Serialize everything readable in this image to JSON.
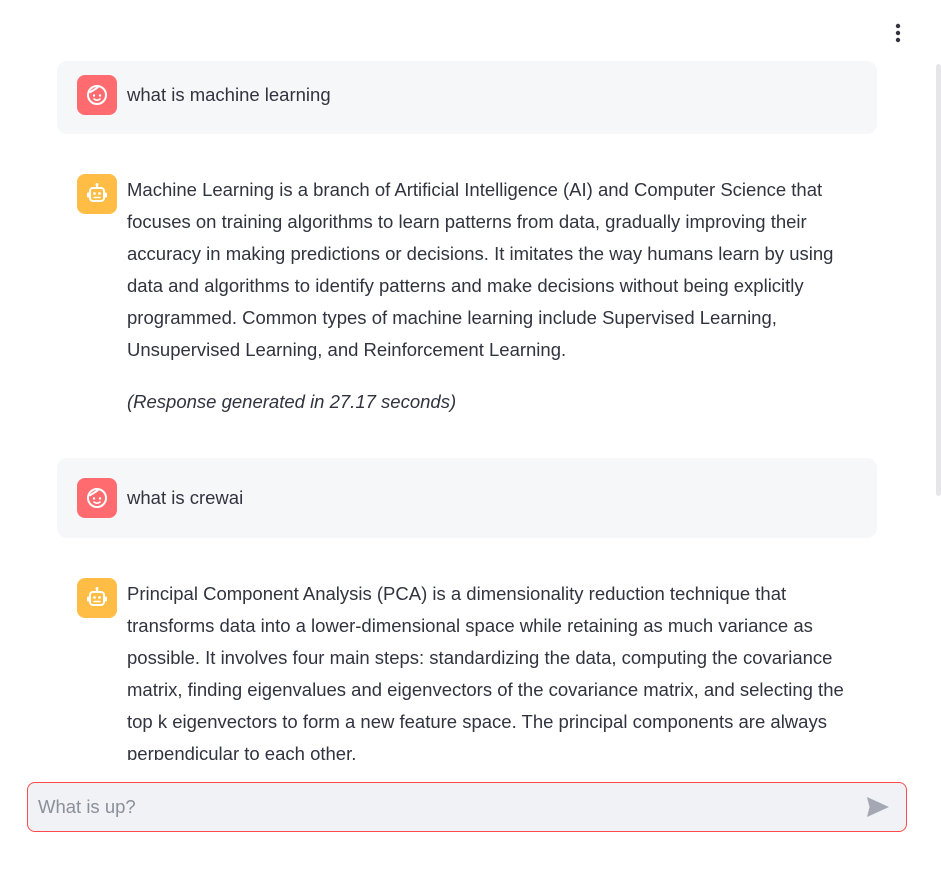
{
  "colors": {
    "user_avatar": "#ff6b6e",
    "assistant_avatar": "#ffbd45",
    "user_bubble": "#f6f7f9",
    "input_border": "#ff4b4b",
    "input_background": "#f0f2f6"
  },
  "header": {
    "menu_icon": "vertical-ellipsis-icon"
  },
  "messages": [
    {
      "role": "user",
      "avatar_icon": "smiley-face-icon",
      "text": "what is machine learning"
    },
    {
      "role": "assistant",
      "avatar_icon": "robot-icon",
      "text": "Machine Learning is a branch of Artificial Intelligence (AI) and Computer Science that focuses on training algorithms to learn patterns from data, gradually improving their accuracy in making predictions or decisions. It imitates the way humans learn by using data and algorithms to identify patterns and make decisions without being explicitly programmed. Common types of machine learning include Supervised Learning, Unsupervised Learning, and Reinforcement Learning.",
      "note": "(Response generated in 27.17 seconds)"
    },
    {
      "role": "user",
      "avatar_icon": "smiley-face-icon",
      "text": "what is crewai"
    },
    {
      "role": "assistant",
      "avatar_icon": "robot-icon",
      "text": "Principal Component Analysis (PCA) is a dimensionality reduction technique that transforms data into a lower-dimensional space while retaining as much variance as possible. It involves four main steps: standardizing the data, computing the covariance matrix, finding eigenvalues and eigenvectors of the covariance matrix, and selecting the top k eigenvectors to form a new feature space. The principal components are always perpendicular to each other."
    }
  ],
  "chat_input": {
    "placeholder": "What is up?",
    "value": "",
    "send_icon": "send-arrow-icon"
  }
}
